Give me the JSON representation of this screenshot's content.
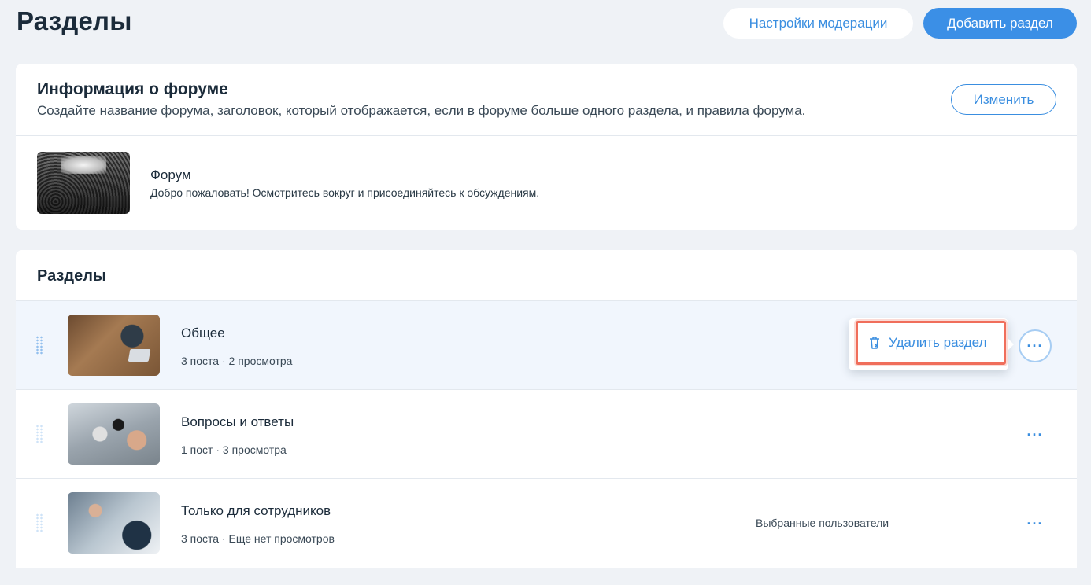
{
  "header": {
    "title": "Разделы",
    "moderation_button": "Настройки модерации",
    "add_section_button": "Добавить раздел"
  },
  "forum_info": {
    "title": "Информация о форуме",
    "description": "Создайте название форума, заголовок, который отображается, если в форуме больше одного раздела, и правила форума.",
    "edit_button": "Изменить",
    "forum_name": "Форум",
    "welcome_text": "Добро пожаловать! Осмотритесь вокруг и присоединяйтесь к обсуждениям."
  },
  "sections": {
    "title": "Разделы",
    "items": [
      {
        "name": "Общее",
        "meta": "3 поста · 2 просмотра",
        "extra": "",
        "image": "workspace-laptop-photo"
      },
      {
        "name": "Вопросы и ответы",
        "meta": "1 пост · 3 просмотра",
        "extra": "",
        "image": "press-microphones-photo"
      },
      {
        "name": "Только для сотрудников",
        "meta": "3 поста · Еще нет просмотров",
        "extra": "Выбранные пользователи",
        "image": "meeting-team-photo"
      }
    ],
    "more_label": "···"
  },
  "popover": {
    "delete_label": "Удалить раздел",
    "icon": "trash-icon",
    "highlight_color": "#f06e5b"
  },
  "colors": {
    "accent": "#3b8fe6",
    "background": "#eff2f6",
    "active_row": "#f1f6fd"
  }
}
